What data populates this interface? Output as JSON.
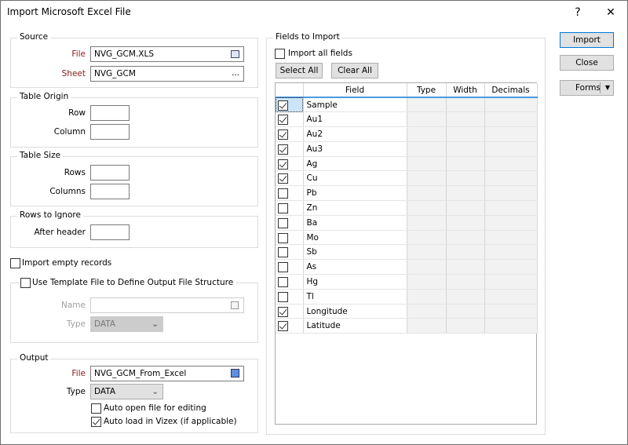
{
  "window": {
    "title": "Import Microsoft Excel File",
    "help": "?",
    "close": "✕"
  },
  "source": {
    "title": "Source",
    "file_label": "File",
    "file_value": "NVG_GCM.XLS",
    "sheet_label": "Sheet",
    "sheet_value": "NVG_GCM",
    "ellipsis": "..."
  },
  "origin": {
    "title": "Table Origin",
    "row_label": "Row",
    "column_label": "Column"
  },
  "size": {
    "title": "Table Size",
    "rows_label": "Rows",
    "columns_label": "Columns"
  },
  "ignore": {
    "title": "Rows to Ignore",
    "after_label": "After header"
  },
  "import_empty": "Import empty records",
  "template": {
    "title": "Use Template File to Define Output File Structure",
    "name_label": "Name",
    "type_label": "Type",
    "type_value": "DATA"
  },
  "output": {
    "title": "Output",
    "file_label": "File",
    "file_value": "NVG_GCM_From_Excel",
    "type_label": "Type",
    "type_value": "DATA",
    "auto_open": "Auto open file for editing",
    "auto_load": "Auto load in Vizex (if applicable)",
    "auto_open_checked": false,
    "auto_load_checked": true
  },
  "fields": {
    "title": "Fields to Import",
    "import_all": "Import all fields",
    "select_all": "Select All",
    "clear_all": "Clear All",
    "columns": [
      "Field",
      "Type",
      "Width",
      "Decimals"
    ],
    "rows": [
      {
        "name": "Sample",
        "checked": true
      },
      {
        "name": "Au1",
        "checked": true
      },
      {
        "name": "Au2",
        "checked": true
      },
      {
        "name": "Au3",
        "checked": true
      },
      {
        "name": "Ag",
        "checked": true
      },
      {
        "name": "Cu",
        "checked": true
      },
      {
        "name": "Pb",
        "checked": false
      },
      {
        "name": "Zn",
        "checked": false
      },
      {
        "name": "Ba",
        "checked": false
      },
      {
        "name": "Mo",
        "checked": false
      },
      {
        "name": "Sb",
        "checked": false
      },
      {
        "name": "As",
        "checked": false
      },
      {
        "name": "Hg",
        "checked": false
      },
      {
        "name": "Tl",
        "checked": false
      },
      {
        "name": "Longitude",
        "checked": true
      },
      {
        "name": "Latitude",
        "checked": true
      }
    ]
  },
  "buttons": {
    "import": "Import",
    "close": "Close",
    "forms": "Forms"
  }
}
